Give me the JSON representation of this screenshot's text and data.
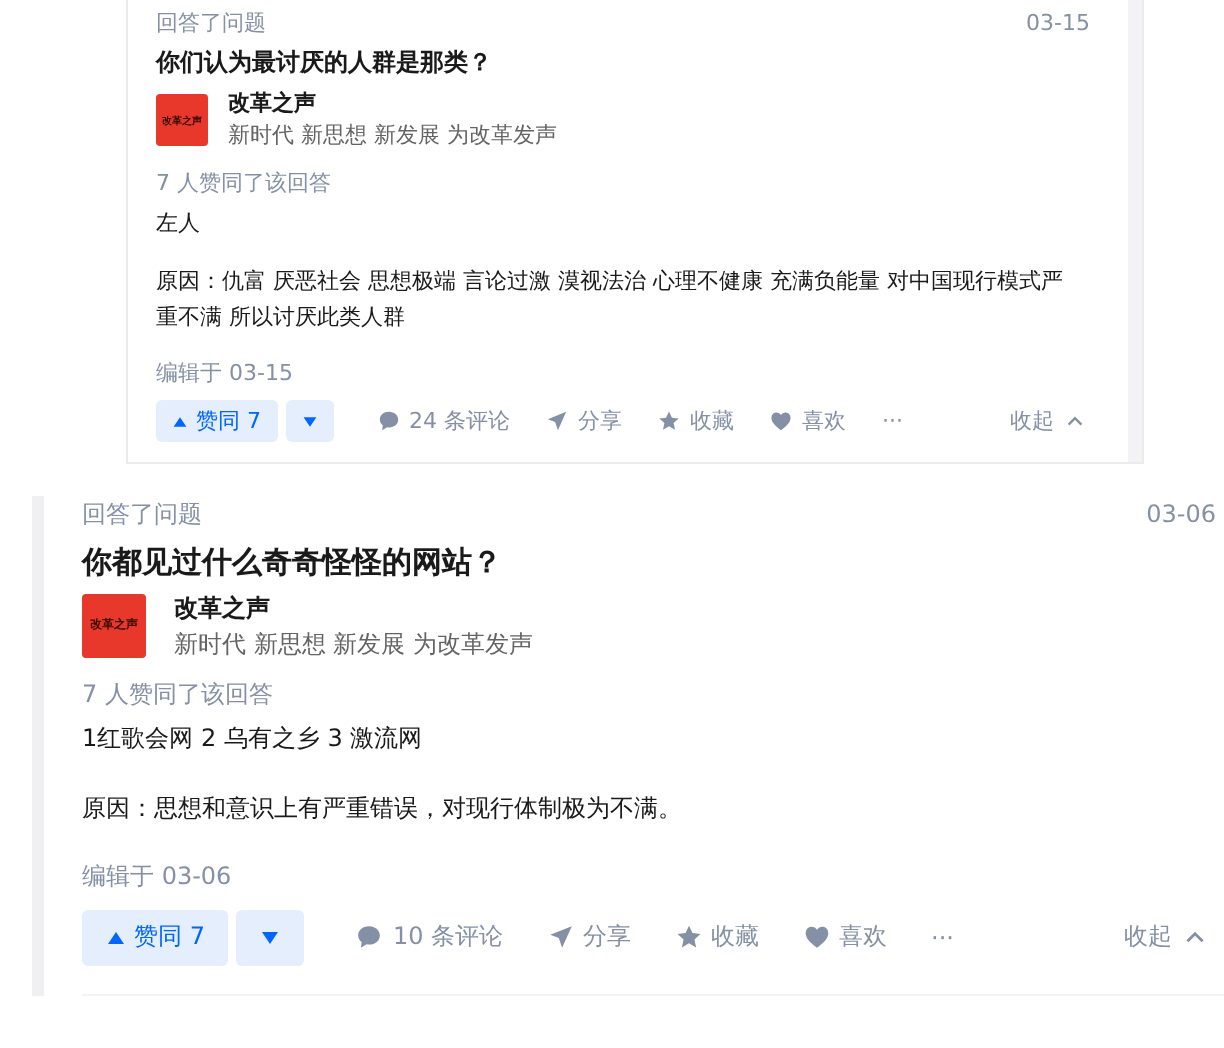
{
  "answers": [
    {
      "action": "回答了问题",
      "date": "03-15",
      "question": "你们认为最讨厌的人群是那类？",
      "author": {
        "name": "改革之声",
        "bio": "新时代 新思想 新发展 为改革发声",
        "avatar_text": "改革之声"
      },
      "votes_summary": "7 人赞同了该回答",
      "content": [
        "左人",
        "原因：仇富 厌恶社会 思想极端 言论过激 漠视法治 心理不健康 充满负能量 对中国现行模式严重不满 所以讨厌此类人群"
      ],
      "edited": "编辑于 03-15",
      "actions": {
        "upvote": "赞同 7",
        "comments": "24 条评论",
        "share": "分享",
        "collect": "收藏",
        "like": "喜欢",
        "more": "···",
        "collapse": "收起"
      }
    },
    {
      "action": "回答了问题",
      "date": "03-06",
      "question": "你都见过什么奇奇怪怪的网站？",
      "author": {
        "name": "改革之声",
        "bio": "新时代 新思想 新发展 为改革发声",
        "avatar_text": "改革之声"
      },
      "votes_summary": "7 人赞同了该回答",
      "content": [
        "1红歌会网 2 乌有之乡 3 激流网",
        "原因：思想和意识上有严重错误，对现行体制极为不满。"
      ],
      "edited": "编辑于 03-06",
      "actions": {
        "upvote": "赞同 7",
        "comments": "10 条评论",
        "share": "分享",
        "collect": "收藏",
        "like": "喜欢",
        "more": "···",
        "collapse": "收起"
      }
    }
  ]
}
